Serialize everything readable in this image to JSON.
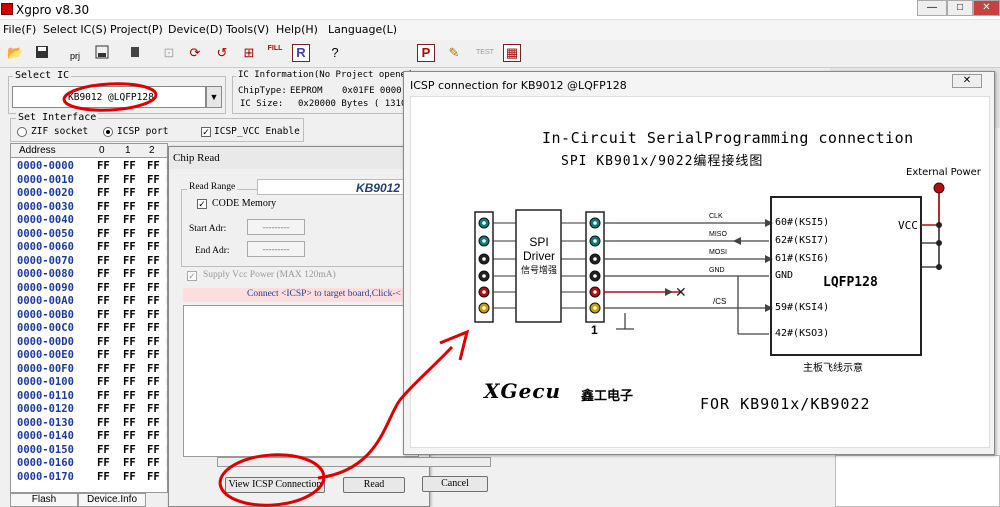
{
  "window": {
    "title": "Xgpro v8.30",
    "min": "—",
    "max": "□",
    "close": "✕"
  },
  "menu": [
    "File(F)",
    "Select IC(S)",
    "Project(P)",
    "Device(D)",
    "Tools(V)",
    "Help(H)",
    "Language(L)"
  ],
  "toolbar": {
    "icons": [
      "open-icon",
      "save-icon",
      "project-icon",
      "save-project-icon",
      "chip-icon",
      "read-icon",
      "verify-icon",
      "blank-check-icon",
      "fill-icon",
      "reload-icon",
      "help-icon",
      "program-icon",
      "edit-icon",
      "test-icon",
      "device-icon"
    ],
    "fill_label": "FILL",
    "test_label": "TEST",
    "prj_label": "prj"
  },
  "select_ic": {
    "legend": "Select IC",
    "value": "KB9012 @LQFP128"
  },
  "ic_info": {
    "legend": "IC Information(No Project opened",
    "chip_type_label": "ChipType:",
    "chip_type": "EEPROM",
    "chip_range": "0x01FE 0000",
    "size_label": "IC Size:",
    "size": "0x20000 Bytes ( 1310"
  },
  "interface": {
    "legend": "Set Interface",
    "zif": "ZIF socket",
    "icsp": "ICSP port",
    "icsp_vcc": "ICSP_VCC Enable"
  },
  "hex": {
    "headers": [
      "Address",
      "0",
      "1",
      "2"
    ],
    "rows": [
      "0000-0000",
      "0000-0010",
      "0000-0020",
      "0000-0030",
      "0000-0040",
      "0000-0050",
      "0000-0060",
      "0000-0070",
      "0000-0080",
      "0000-0090",
      "0000-00A0",
      "0000-00B0",
      "0000-00C0",
      "0000-00D0",
      "0000-00E0",
      "0000-00F0",
      "0000-0100",
      "0000-0110",
      "0000-0120",
      "0000-0130",
      "0000-0140",
      "0000-0150",
      "0000-0160",
      "0000-0170"
    ],
    "cell": "FF"
  },
  "bottom_tabs": [
    "Flash",
    "Device.Info"
  ],
  "chip_read": {
    "title": "Chip Read",
    "range_legend": "Read Range",
    "chip": "KB9012",
    "code_memory": "CODE Memory",
    "start_label": "Start Adr:",
    "end_label": "End Adr:",
    "placeholder": "---------",
    "supply": "Supply Vcc Power (MAX 120mA)",
    "connect_msg": "Connect <ICSP> to target board,Click-<",
    "view_btn": "View ICSP Connection",
    "read_btn": "Read",
    "cancel_btn": "Cancel"
  },
  "icsp": {
    "title": "ICSP connection for  KB9012 @LQFP128",
    "close": "✕",
    "heading1": "In-Circuit SerialProgramming connection",
    "heading2": "SPI  KB901x/9022编程接线图",
    "ext_power": "External Power",
    "driver_lines": [
      "SPI",
      "Driver",
      "信号增强"
    ],
    "pin_one": "1",
    "signals": [
      "CLK",
      "MISO",
      "MOSI",
      "GND",
      "/CS"
    ],
    "chip_pins": [
      "60#(KSI5)",
      "62#(KSI7)",
      "61#(KSI6)",
      "GND",
      "59#(KSI4)",
      "42#(KSO3)"
    ],
    "vcc": "VCC",
    "chip_name": "LQFP128",
    "caption": "主板飞线示意",
    "brand": "XGecu",
    "brand_cn": "鑫工电子",
    "footer": "FOR  KB901x/KB9022",
    "colors": {
      "dot_teal": "#0b7d7d",
      "dot_dark": "#222",
      "dot_red": "#b01010",
      "dot_yellow": "#c8a000",
      "wire_red": "#b01010"
    }
  },
  "annotation_color": "#e00000"
}
